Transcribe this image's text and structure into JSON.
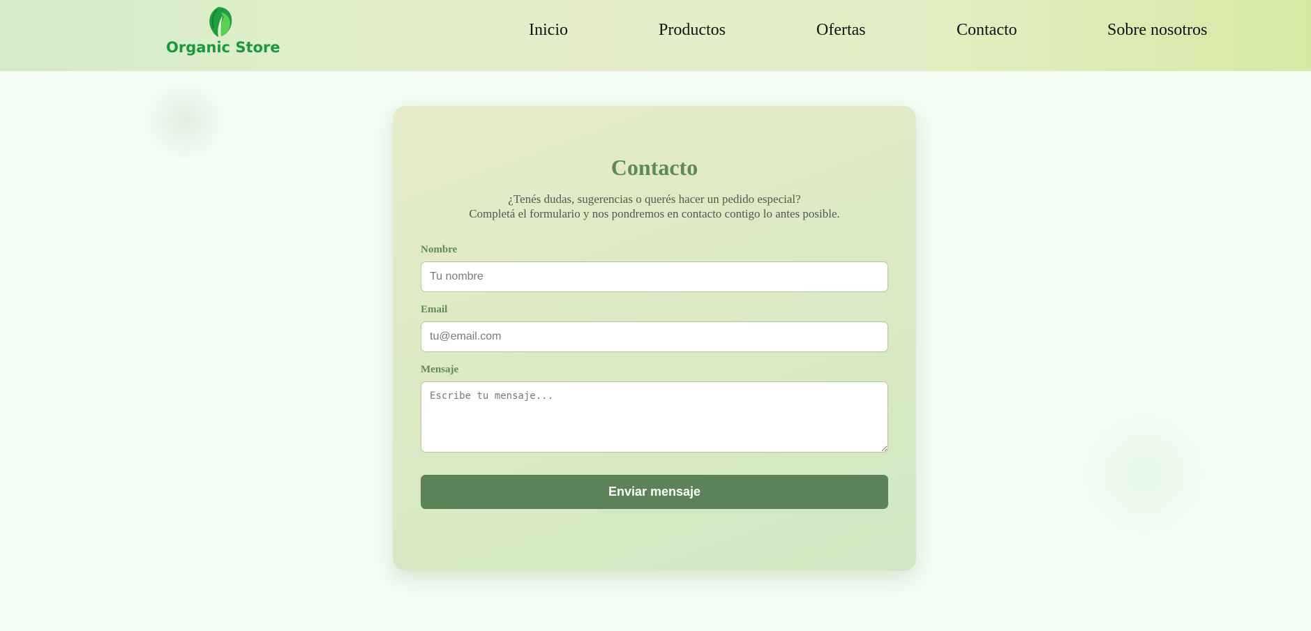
{
  "header": {
    "logo_text": "Organic Store",
    "nav": [
      "Inicio",
      "Productos",
      "Ofertas",
      "Contacto",
      "Sobre nosotros"
    ]
  },
  "contact": {
    "title": "Contacto",
    "subtitle_line1": "¿Tenés dudas, sugerencias o querés hacer un pedido especial?",
    "subtitle_line2": "Completá el formulario y nos pondremos en contacto contigo lo antes posible.",
    "fields": {
      "nombre": {
        "label": "Nombre",
        "placeholder": "Tu nombre",
        "value": ""
      },
      "email": {
        "label": "Email",
        "placeholder": "tu@email.com",
        "value": ""
      },
      "mensaje": {
        "label": "Mensaje",
        "placeholder": "Escribe tu mensaje...",
        "value": ""
      }
    },
    "submit_label": "Enviar mensaje"
  },
  "colors": {
    "brand_green": "#199a3a",
    "title_green": "#5e8a55",
    "button_green": "#5b8258",
    "page_bg": "#f2fdf3"
  },
  "icons": [
    "leaf-logo-icon"
  ]
}
